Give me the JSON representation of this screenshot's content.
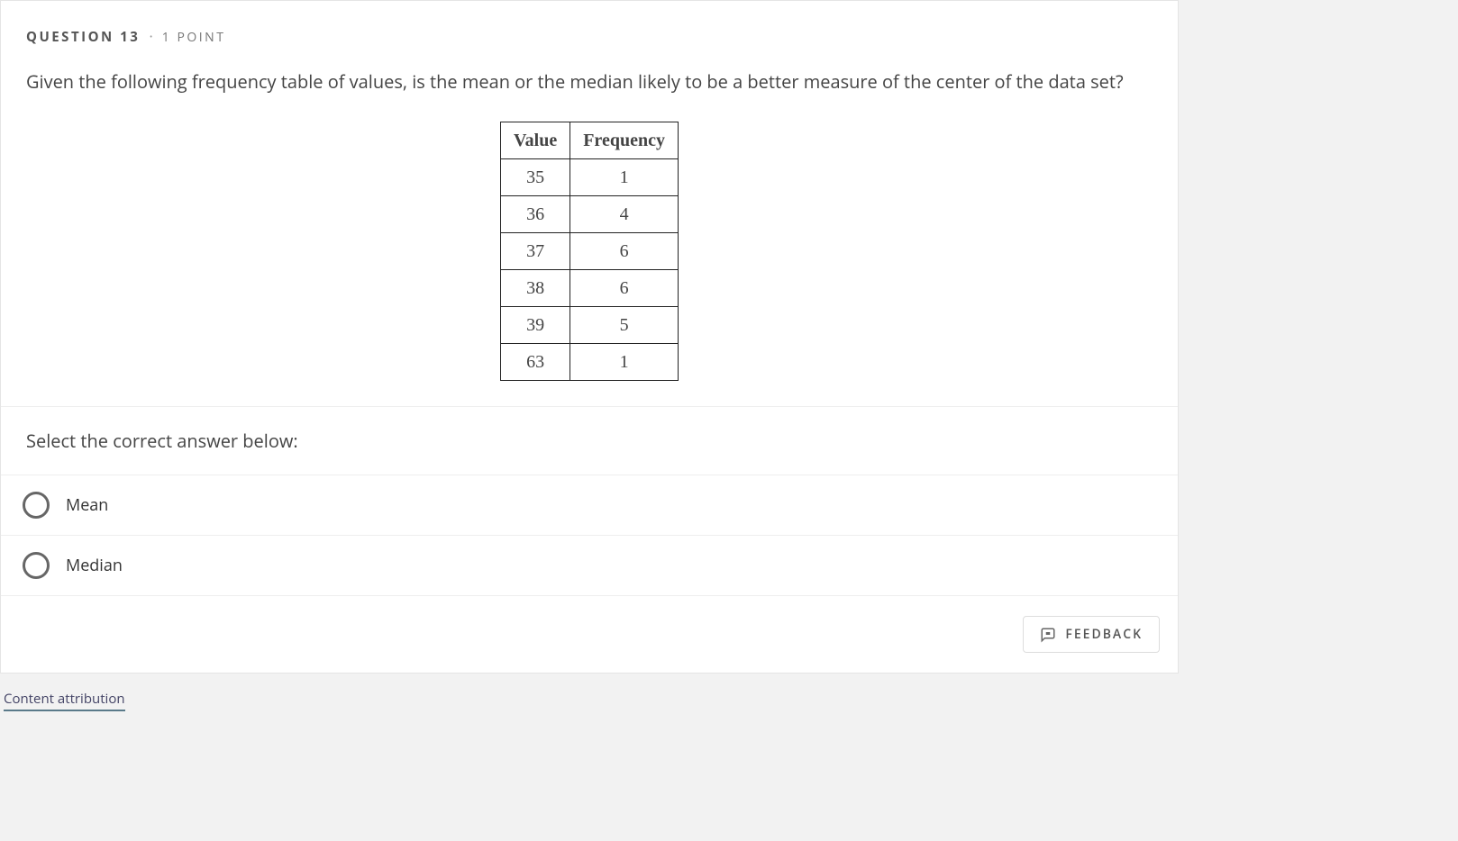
{
  "header": {
    "question_label": "QUESTION 13",
    "points_label": "1 POINT"
  },
  "question": {
    "prompt": "Given the following frequency table of values, is the mean or the median likely to be a better measure of the center of the data set?"
  },
  "table": {
    "headers": [
      "Value",
      "Frequency"
    ],
    "rows": [
      {
        "value": "35",
        "freq": "1"
      },
      {
        "value": "36",
        "freq": "4"
      },
      {
        "value": "37",
        "freq": "6"
      },
      {
        "value": "38",
        "freq": "6"
      },
      {
        "value": "39",
        "freq": "5"
      },
      {
        "value": "63",
        "freq": "1"
      }
    ]
  },
  "select_prompt": "Select the correct answer below:",
  "options": [
    {
      "label": "Mean"
    },
    {
      "label": "Median"
    }
  ],
  "feedback_label": "FEEDBACK",
  "attribution_label": "Content attribution",
  "chart_data": {
    "type": "table",
    "title": "Frequency table",
    "columns": [
      "Value",
      "Frequency"
    ],
    "rows": [
      [
        35,
        1
      ],
      [
        36,
        4
      ],
      [
        37,
        6
      ],
      [
        38,
        6
      ],
      [
        39,
        5
      ],
      [
        63,
        1
      ]
    ]
  }
}
